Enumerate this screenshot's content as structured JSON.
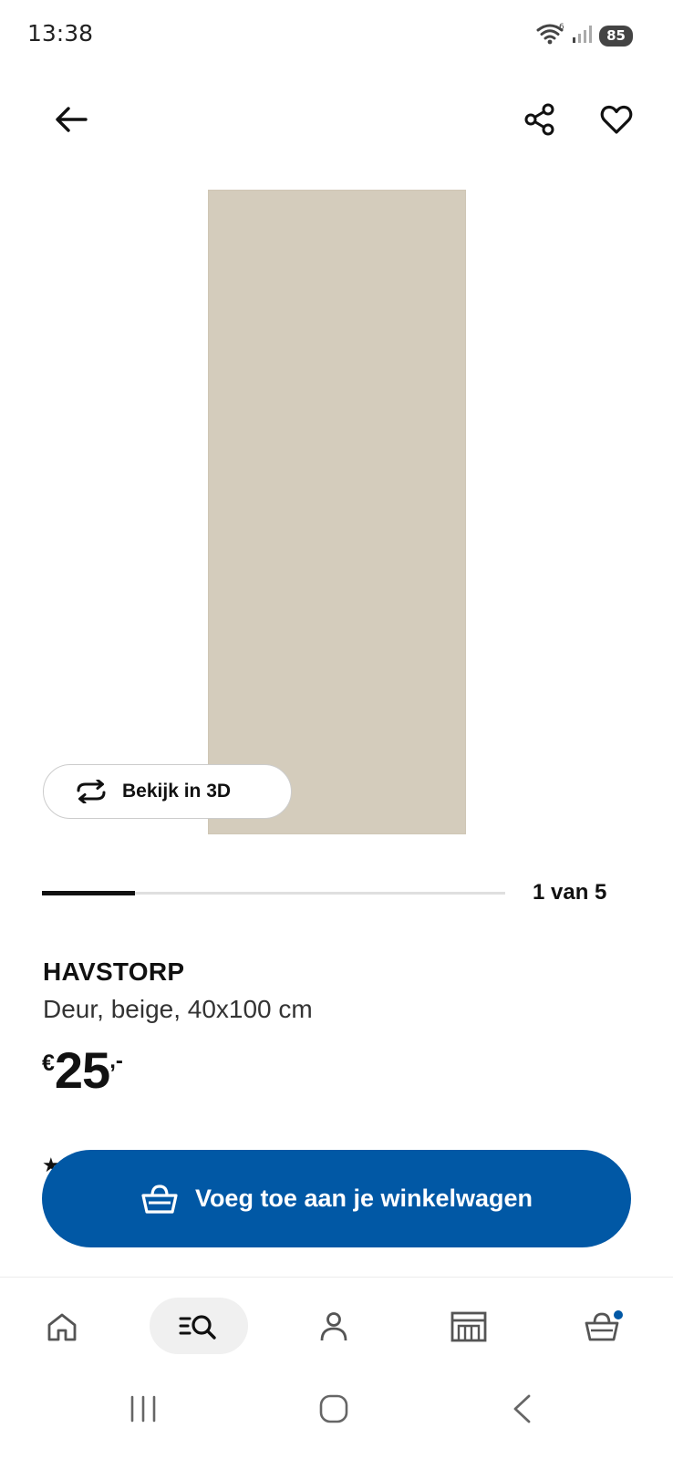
{
  "status_bar": {
    "time": "13:38",
    "battery": "85",
    "icons": [
      "wifi-icon",
      "signal-icon",
      "battery-icon"
    ]
  },
  "header": {
    "icons": [
      "back-arrow-icon",
      "share-icon",
      "heart-icon"
    ]
  },
  "gallery": {
    "view3d_label": "Bekijk in 3D",
    "page_counter": "1 van 5",
    "current_page": 1,
    "total_pages": 5,
    "progress_fraction": 0.2,
    "image_color": "#d4ccbc"
  },
  "product": {
    "name": "HAVSTORP",
    "description": "Deur, beige, 40x100 cm",
    "price_currency": "€",
    "price_amount": "25",
    "price_suffix": ",-"
  },
  "cart_button": {
    "label": "Voeg toe aan je winkelwagen",
    "color": "#0158a5"
  },
  "bottom_nav": {
    "items": [
      "home-icon",
      "search-icon",
      "account-icon",
      "store-icon",
      "cart-icon"
    ],
    "active": "search-icon",
    "cart_badge_color": "#0158a5"
  }
}
